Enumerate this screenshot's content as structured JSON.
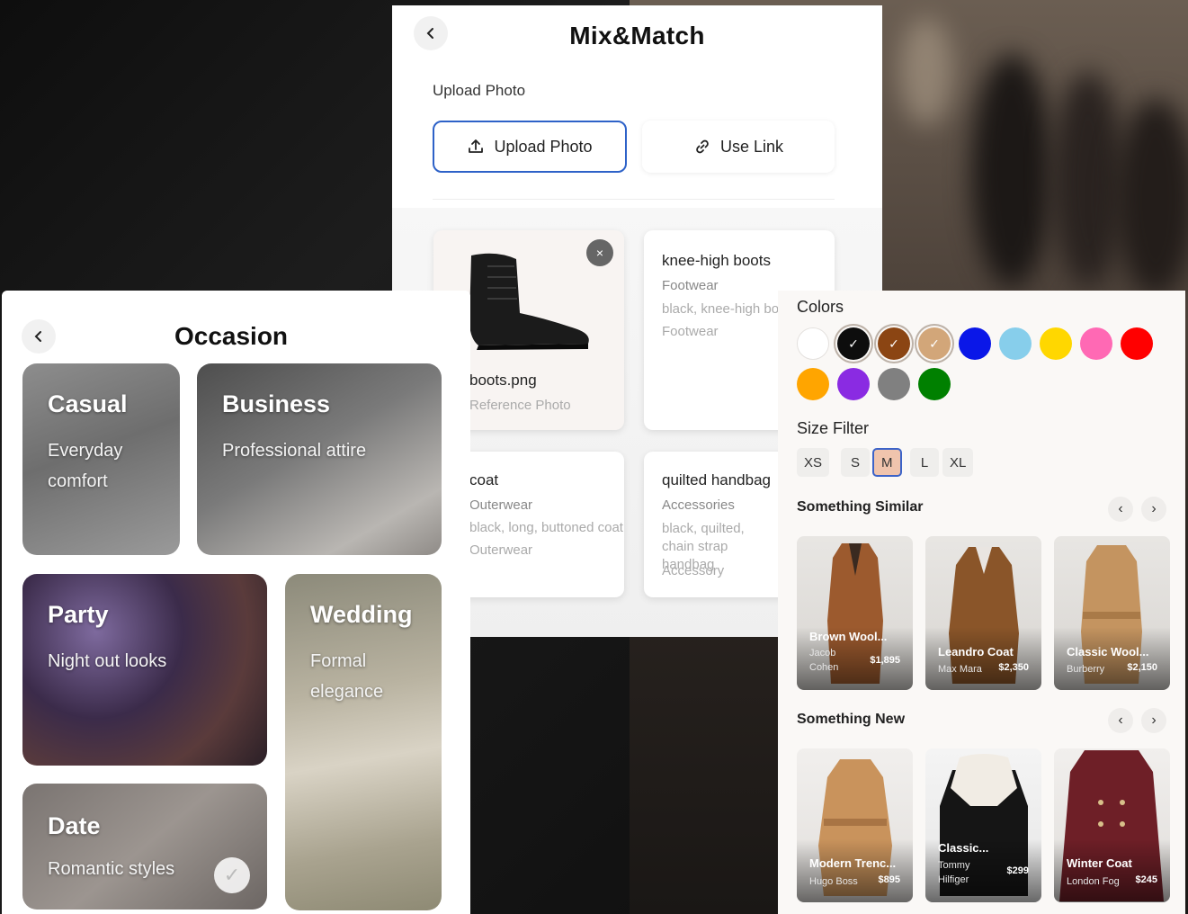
{
  "mix": {
    "title": "Mix&Match",
    "upload_section_label": "Upload Photo",
    "upload_button": "Upload Photo",
    "link_button": "Use Link",
    "cards": [
      {
        "filename": "boots.png",
        "caption": "Reference Photo"
      },
      {
        "title": "knee-high boots",
        "category": "Footwear",
        "desc": "black, knee-high boots",
        "type": "Footwear"
      },
      {
        "title": "coat",
        "category": "Outerwear",
        "desc": "black, long, buttoned coat",
        "type": "Outerwear"
      },
      {
        "title": "quilted handbag",
        "category": "Accessories",
        "desc": "black, quilted, chain strap handbag",
        "type": "Accessory"
      }
    ],
    "close_symbol": "×"
  },
  "occasion": {
    "title": "Occasion",
    "tiles": [
      {
        "name": "Casual",
        "desc": "Everyday comfort"
      },
      {
        "name": "Business",
        "desc": "Professional attire"
      },
      {
        "name": "Party",
        "desc": "Night out looks"
      },
      {
        "name": "Wedding",
        "desc": "Formal elegance"
      },
      {
        "name": "Date",
        "desc": "Romantic styles"
      }
    ]
  },
  "filters": {
    "colors_label": "Colors",
    "colors": [
      {
        "hex": "#ffffff",
        "selected": false
      },
      {
        "hex": "#0d0d0d",
        "selected": true
      },
      {
        "hex": "#8b4513",
        "selected": true
      },
      {
        "hex": "#d2a679",
        "selected": true
      },
      {
        "hex": "#0a17e8",
        "selected": false
      },
      {
        "hex": "#87ceeb",
        "selected": false
      },
      {
        "hex": "#ffd700",
        "selected": false
      },
      {
        "hex": "#ff69b4",
        "selected": false
      },
      {
        "hex": "#ff0000",
        "selected": false
      },
      {
        "hex": "#ffa500",
        "selected": false
      },
      {
        "hex": "#8a2be2",
        "selected": false
      },
      {
        "hex": "#808080",
        "selected": false
      },
      {
        "hex": "#008000",
        "selected": false
      }
    ],
    "size_label": "Size Filter",
    "sizes": [
      "XS",
      "S",
      "M",
      "L",
      "XL"
    ],
    "active_size": "M",
    "similar_label": "Something Similar",
    "similar": [
      {
        "name": "Brown Wool...",
        "brand": "Jacob Cohen",
        "price": "$1,895"
      },
      {
        "name": "Leandro Coat",
        "brand": "Max Mara",
        "price": "$2,350"
      },
      {
        "name": "Classic Wool...",
        "brand": "Burberry",
        "price": "$2,150"
      }
    ],
    "new_label": "Something New",
    "new_items": [
      {
        "name": "Modern Trenc...",
        "brand": "Hugo Boss",
        "price": "$895"
      },
      {
        "name": "Classic...",
        "brand": "Tommy Hilfiger",
        "price": "$299"
      },
      {
        "name": "Winter Coat",
        "brand": "London Fog",
        "price": "$245"
      }
    ]
  }
}
